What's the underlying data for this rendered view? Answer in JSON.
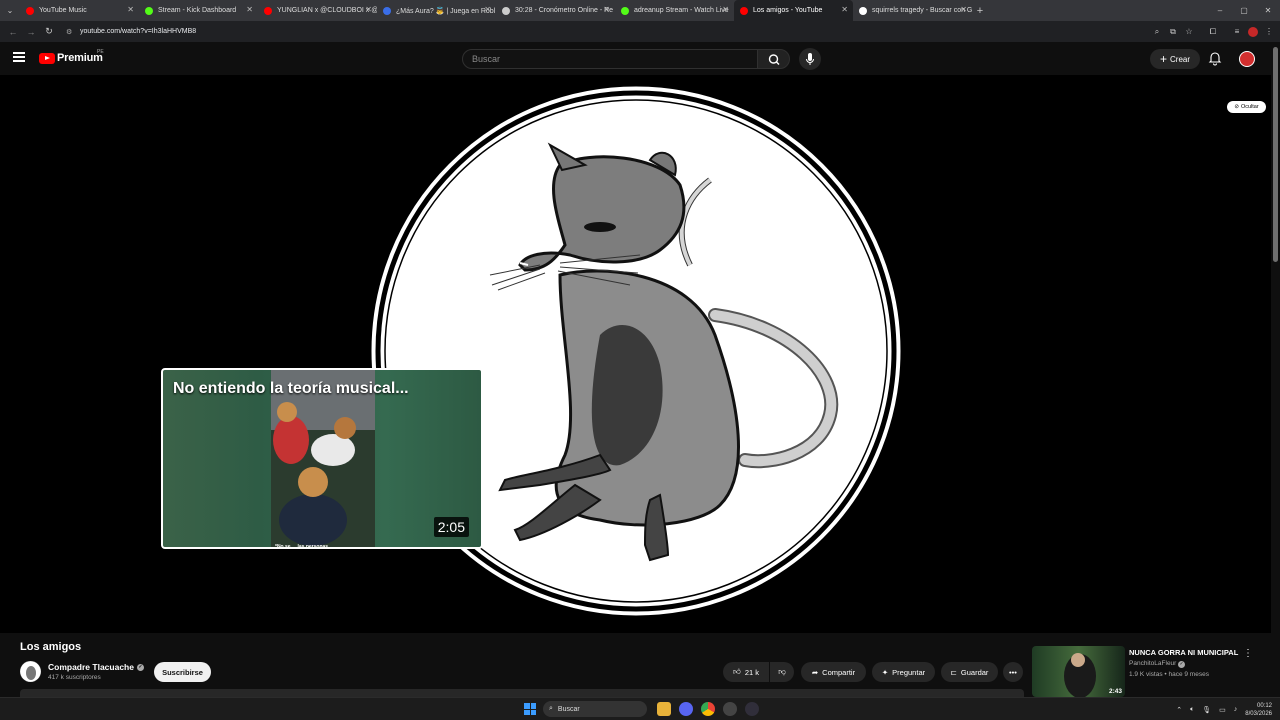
{
  "browser": {
    "tabs": [
      {
        "label": "YouTube Music",
        "color": "#ff0000"
      },
      {
        "label": "Stream - Kick Dashboard",
        "color": "#53fc18"
      },
      {
        "label": "YUNGLIAN x @CLOUDBOI x @",
        "color": "#ff0000"
      },
      {
        "label": "¿Más Aura? 👼 | Juega en Robl",
        "color": "#3a6ee8"
      },
      {
        "label": "30:28 - Cronómetro Online - Re",
        "color": "#cccccc"
      },
      {
        "label": "adreanup Stream - Watch Live",
        "color": "#53fc18"
      },
      {
        "label": "Los amigos - YouTube",
        "color": "#ff0000",
        "active": true
      },
      {
        "label": "squirrels tragedy - Buscar con G",
        "color": "#ffffff"
      }
    ],
    "url": "youtube.com/watch?v=Ih3laHHVMB8"
  },
  "youtube": {
    "logo_text": "Premium",
    "country_code": "PE",
    "search_placeholder": "Buscar",
    "create_label": "Crear"
  },
  "player": {
    "hide_label": "Ocultar",
    "endcard": {
      "title": "No entiendo la teoría musical...",
      "duration": "2:05",
      "caption": "*No se ... las personas"
    }
  },
  "video": {
    "title": "Los amigos",
    "channel": "Compadre Tlacuache",
    "subscribers": "417 k suscriptores",
    "subscribe_label": "Suscribirse",
    "likes": "21 k",
    "share_label": "Compartir",
    "ask_label": "Preguntar",
    "save_label": "Guardar"
  },
  "recommendation": {
    "title": "NUNCA GORRA NI MUNICIPAL",
    "channel": "PanchitoLaFleur",
    "meta": "1.9 K vistas • hace 9 meses",
    "duration": "2:43"
  },
  "taskbar": {
    "search_label": "Buscar",
    "time": "00:12",
    "date": "8/03/2026"
  }
}
